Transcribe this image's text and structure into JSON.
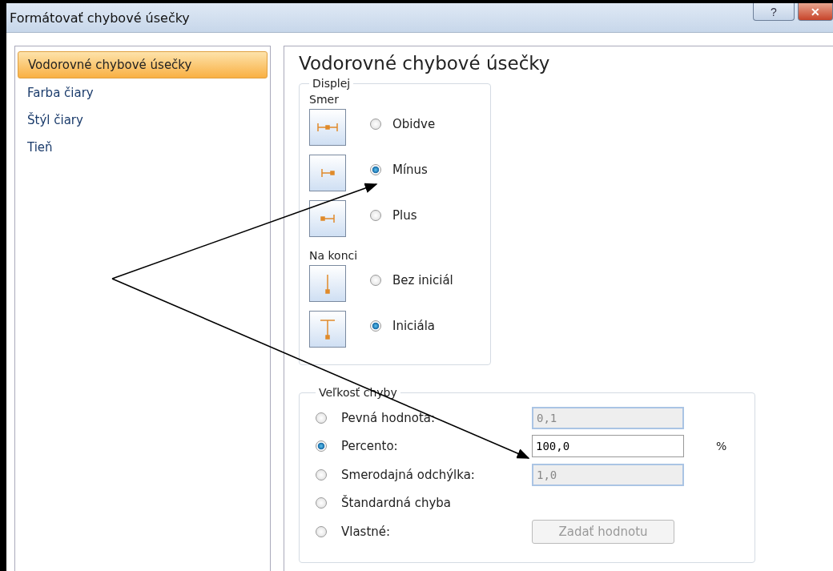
{
  "window": {
    "title": "Formátovať chybové úsečky",
    "buttons": [
      {
        "kind": "help",
        "label": "?"
      },
      {
        "kind": "close",
        "label": "✕"
      }
    ]
  },
  "sidebar": {
    "items": [
      {
        "label": "Vodorovné chybové úsečky",
        "selected": true
      },
      {
        "label": "Farba čiary",
        "selected": false
      },
      {
        "label": "Štýl čiary",
        "selected": false
      },
      {
        "label": "Tieň",
        "selected": false
      }
    ]
  },
  "panel": {
    "heading": "Vodorovné chybové úsečky",
    "display": {
      "title": "Displej",
      "groups": [
        {
          "label": "Smer",
          "options": [
            {
              "kind": "both",
              "label": "Obidve",
              "selected": false
            },
            {
              "kind": "minus",
              "label": "Mínus",
              "selected": true
            },
            {
              "kind": "plus",
              "label": "Plus",
              "selected": false
            }
          ]
        },
        {
          "label": "Na konci",
          "options": [
            {
              "kind": "no-cap",
              "label": "Bez iniciál",
              "selected": false
            },
            {
              "kind": "cap",
              "label": "Iniciála",
              "selected": true
            }
          ]
        }
      ]
    },
    "error_amount": {
      "title": "Veľkosť chyby",
      "options": [
        {
          "kind": "field",
          "label": "Pevná hodnota:",
          "selected": false,
          "value": "0,1",
          "disabled": true
        },
        {
          "kind": "field",
          "label": "Percento:",
          "selected": true,
          "value": "100,0",
          "disabled": false,
          "unit": "%"
        },
        {
          "kind": "field",
          "label": "Smerodajná odchýlka:",
          "selected": false,
          "value": "1,0",
          "disabled": true
        },
        {
          "kind": "plain",
          "label": "Štandardná chyba",
          "selected": false
        },
        {
          "kind": "button",
          "label": "Vlastné:",
          "selected": false,
          "button": "Zadať hodnotu",
          "disabled": true
        }
      ]
    }
  },
  "annotations": [
    {
      "kind": "arrow"
    },
    {
      "kind": "arrow"
    }
  ]
}
